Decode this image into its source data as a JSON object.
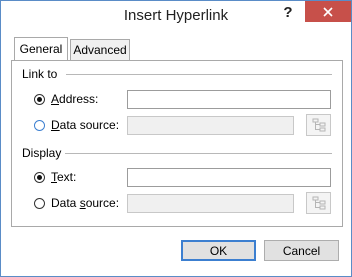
{
  "dialog": {
    "title": "Insert Hyperlink",
    "help_glyph": "?",
    "close_icon": "close-icon",
    "close_color": "#c7504a"
  },
  "tabs": [
    {
      "label": "General",
      "active": true
    },
    {
      "label": "Advanced",
      "active": false
    }
  ],
  "link_to": {
    "group_label": "Link to",
    "address": {
      "accel": "A",
      "rest": "ddress:",
      "selected": true,
      "value": ""
    },
    "data_source": {
      "prefix": "",
      "accel": "D",
      "rest": "ata source:",
      "selected": false,
      "enabled": false
    }
  },
  "display": {
    "group_label": "Display",
    "text": {
      "accel": "T",
      "rest": "ext:",
      "selected": true,
      "value": ""
    },
    "data_source": {
      "prefix": "Data ",
      "accel": "s",
      "rest": "ource:",
      "selected": false,
      "enabled": false
    }
  },
  "buttons": {
    "ok": "OK",
    "cancel": "Cancel"
  }
}
